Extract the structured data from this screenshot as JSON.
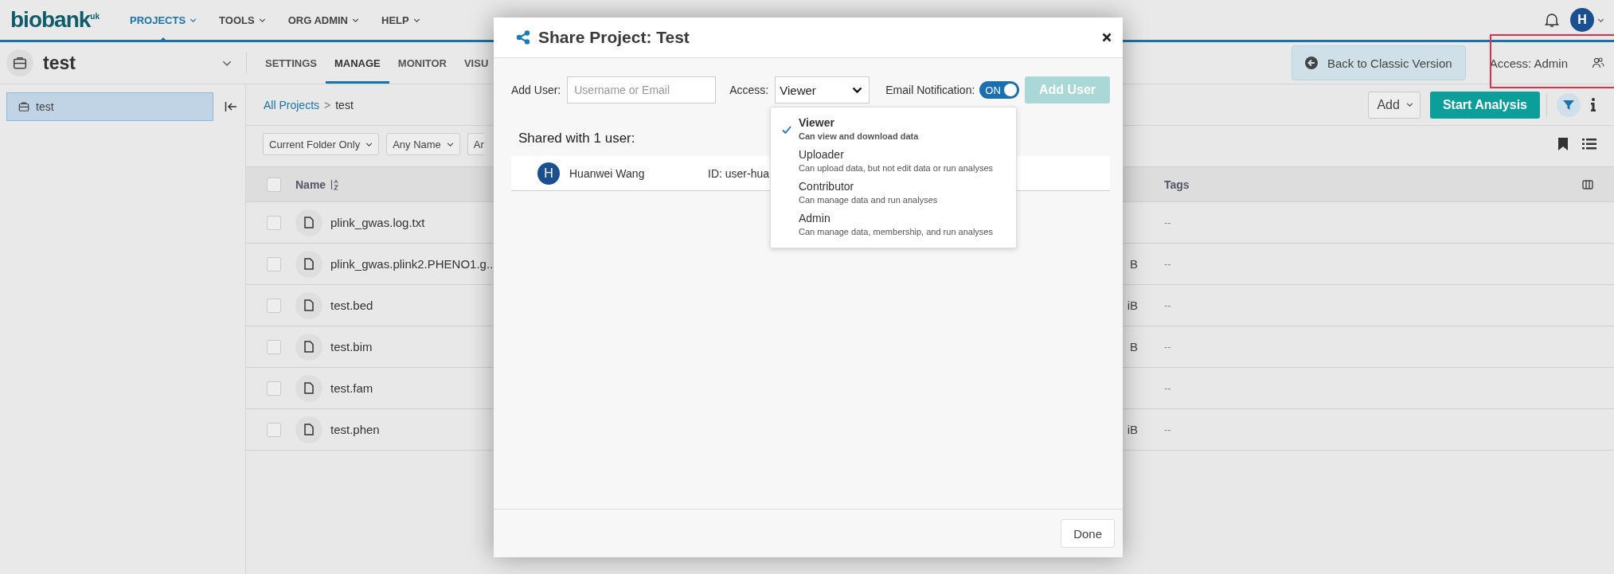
{
  "header": {
    "logo": "biobank$^{uk}$",
    "nav": [
      {
        "label": "PROJECTS",
        "selected": true
      },
      {
        "label": "TOOLS",
        "selected": false
      },
      {
        "label": "ORG ADMIN",
        "selected": false
      },
      {
        "label": "HELP",
        "selected": false
      }
    ],
    "avatar": "H"
  },
  "project_bar": {
    "name": "test",
    "tabs": [
      {
        "label": "SETTINGS",
        "selected": false
      },
      {
        "label": "MANAGE",
        "selected": true
      },
      {
        "label": "MONITOR",
        "selected": false
      },
      {
        "label": "VISU",
        "selected": false
      }
    ],
    "back_button": "Back to Classic Version",
    "access": "Access: Admin"
  },
  "sidebar": {
    "items": [
      {
        "label": "test",
        "selected": true
      }
    ]
  },
  "breadcrumb": {
    "link": "All Projects",
    "separator": ">",
    "current": "test"
  },
  "actions": {
    "add": "Add",
    "start": "Start Analysis"
  },
  "filters": [
    "Current Folder Only",
    "Any Name",
    "Ar"
  ],
  "table": {
    "all_checked": false,
    "columns": {
      "name": "Name",
      "tags": "Tags"
    },
    "rows": [
      {
        "name": "plink_gwas.log.txt",
        "tags": "--",
        "checked": false
      },
      {
        "name": "plink_gwas.plink2.PHENO1.g..",
        "column_3": "B",
        "tags": "--",
        "checked": false
      },
      {
        "name": "test.bed",
        "column_3": "iB",
        "tags": "--",
        "checked": false
      },
      {
        "name": "test.bim",
        "column_3": "B",
        "tags": "--",
        "checked": false
      },
      {
        "name": "test.fam",
        "tags": "--",
        "checked": false
      },
      {
        "name": "test.phen",
        "column_3": "iB",
        "tags": "--",
        "checked": false
      }
    ]
  },
  "dialog": {
    "title": "Share Project: Test",
    "add_user_label": "Add User:",
    "user_placeholder": "Username or Email",
    "access_label": "Access:",
    "access_value": "Viewer",
    "email_label": "Email Notification:",
    "email_toggle": {
      "label": "ON",
      "on": true
    },
    "add_button": {
      "label": "Add User",
      "disabled": true
    },
    "shared_heading": "Shared with 1 user:",
    "members": [
      {
        "initial": "H",
        "name": "Huanwei Wang",
        "id": "ID: user-hua"
      }
    ],
    "access_options": [
      {
        "label": "Viewer",
        "description": "Can view and download data",
        "selected": true
      },
      {
        "label": "Uploader",
        "description": "Can upload data, but not edit data or run analyses",
        "selected": false
      },
      {
        "label": "Contributor",
        "description": "Can manage data and run analyses",
        "selected": false
      },
      {
        "label": "Admin",
        "description": "Can manage data, membership, and run analyses",
        "selected": false
      }
    ],
    "done": "Done"
  }
}
